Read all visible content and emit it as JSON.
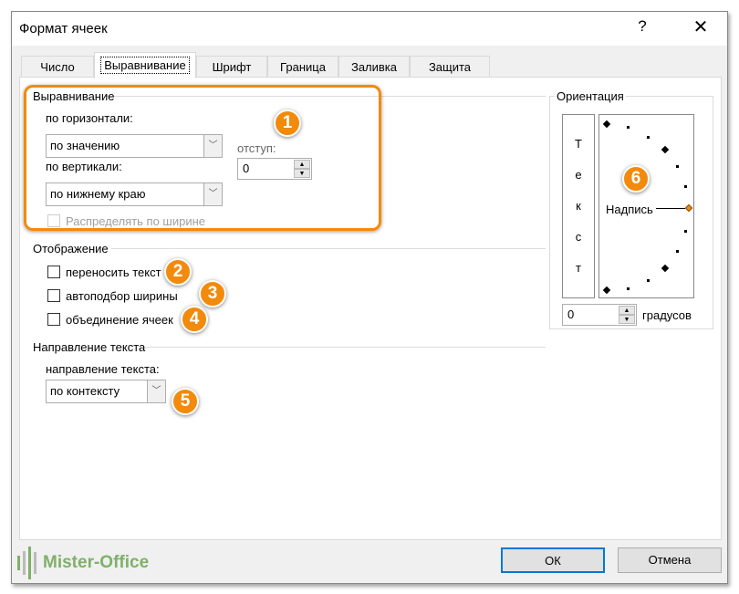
{
  "window": {
    "title": "Формат ячеек",
    "help": "?",
    "close": "✕"
  },
  "tabs": [
    "Число",
    "Выравнивание",
    "Шрифт",
    "Граница",
    "Заливка",
    "Защита"
  ],
  "alignment": {
    "group": "Выравнивание",
    "horizontal_label": "по горизонтали:",
    "horizontal_value": "по значению",
    "vertical_label": "по вертикали:",
    "vertical_value": "по нижнему краю",
    "indent_label": "отступ:",
    "indent_value": "0",
    "distribute_label": "Распределять по ширине"
  },
  "display": {
    "group": "Отображение",
    "wrap": "переносить текст",
    "shrink": "автоподбор ширины",
    "merge": "объединение ячеек"
  },
  "direction": {
    "group": "Направление текста",
    "label": "направление текста:",
    "value": "по контексту"
  },
  "orientation": {
    "group": "Ориентация",
    "vertical_text": "Т е к с т",
    "label": "Надпись",
    "degrees_value": "0",
    "degrees_label": "градусов"
  },
  "badges": [
    "1",
    "2",
    "3",
    "4",
    "5",
    "6"
  ],
  "buttons": {
    "ok": "ОК",
    "cancel": "Отмена"
  },
  "watermark": "Mister-Office",
  "colors": {
    "accent": "#f28a0c",
    "focus": "#0078d7"
  }
}
